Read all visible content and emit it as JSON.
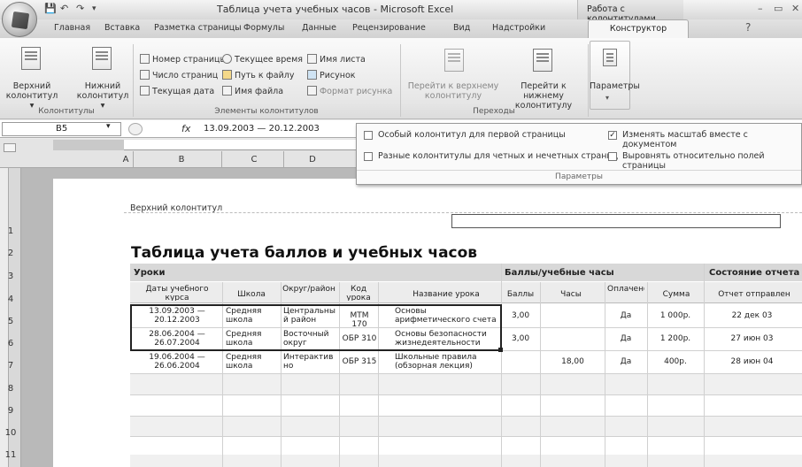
{
  "window": {
    "title": "Таблица учета учебных часов - Microsoft Excel",
    "context_title": "Работа с колонтитулами",
    "min": "–",
    "restore": "▭",
    "close": "✕"
  },
  "tabs": [
    "Главная",
    "Вставка",
    "Разметка страницы",
    "Формулы",
    "Данные",
    "Рецензирование",
    "Вид",
    "Надстройки"
  ],
  "active_tab": "Конструктор",
  "ribbon": {
    "header_btn": [
      "Верхний",
      "колонтитул ▾"
    ],
    "footer_btn": [
      "Нижний",
      "колонтитул ▾"
    ],
    "group1_label": "Колонтитулы",
    "elements": [
      "Номер страницы",
      "Число страниц",
      "Текущая дата",
      "Текущее время",
      "Путь к файлу",
      "Имя файла",
      "Имя листа",
      "Рисунок",
      "Формат рисунка"
    ],
    "group2_label": "Элементы колонтитулов",
    "goto_header": [
      "Перейти к верхнему",
      "колонтитулу"
    ],
    "goto_footer": [
      "Перейти к нижнему",
      "колонтитулу"
    ],
    "group3_label": "Переходы",
    "params_btn": "Параметры"
  },
  "formula_bar": {
    "name_box": "B5",
    "fx": "fx",
    "value": "13.09.2003 — 20.12.2003"
  },
  "params_popup": {
    "opt1": "Особый колонтитул для первой страницы",
    "opt1_checked": false,
    "opt2": "Разные колонтитулы для четных и нечетных страниц",
    "opt2_checked": false,
    "opt3": "Изменять масштаб вместе с документом",
    "opt3_checked": true,
    "opt4": "Выровнять относительно полей страницы",
    "opt4_checked": false,
    "label": "Параметры"
  },
  "columns": [
    "A",
    "B",
    "C",
    "D"
  ],
  "rows": [
    "1",
    "2",
    "3",
    "4",
    "5",
    "6",
    "7",
    "8",
    "9",
    "10",
    "11"
  ],
  "sheet": {
    "header_label": "Верхний колонтитул",
    "title": "Таблица учета баллов и учебных часов",
    "section_lessons": "Уроки",
    "section_scores": "Баллы/учебные часы",
    "section_report": "Состояние отчета",
    "col_headers": [
      "Даты учебного курса",
      "Школа",
      "Округ/район",
      "Код урока",
      "Название урока",
      "Баллы",
      "Часы",
      "Оплачено",
      "Сумма",
      "Отчет отправлен"
    ],
    "data_rows": [
      [
        "13.09.2003 —\n20.12.2003",
        "Средняя\nшкола",
        "Центральны\nй район",
        "МТМ 170",
        "Основы\nарифметического счета",
        "3,00",
        "",
        "Да",
        "1 000р.",
        "22 дек 03"
      ],
      [
        "28.06.2004 —\n26.07.2004",
        "Средняя\nшкола",
        "Восточный\nокруг",
        "ОБР 310",
        "Основы безопасности\nжизнедеятельности",
        "3,00",
        "",
        "Да",
        "1 200р.",
        "27 июн 03"
      ],
      [
        "19.06.2004 —\n26.06.2004",
        "Средняя\nшкола",
        "Интерактив\nно",
        "ОБР 315",
        "Школьные правила\n(обзорная лекция)",
        "",
        "18,00",
        "Да",
        "400р.",
        "28 июн 04"
      ]
    ]
  }
}
